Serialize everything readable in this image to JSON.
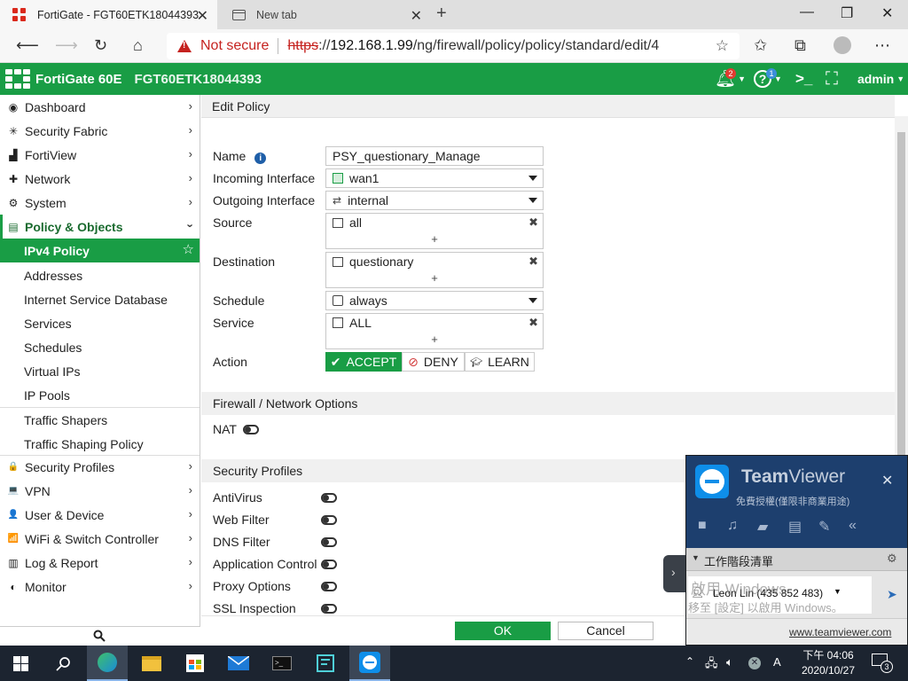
{
  "browser": {
    "tabs": [
      {
        "title": "FortiGate - FGT60ETK18044393",
        "close": "✕"
      },
      {
        "title": "New tab",
        "close": "✕"
      }
    ],
    "new_tab": "+",
    "window_controls": {
      "minimize": "—",
      "restore": "❐",
      "close": "✕"
    },
    "security_label": "Not secure",
    "url_scheme": "https",
    "url_sep": "://",
    "url_host": "192.168.1.99",
    "url_path": "/ng/firewall/policy/policy/standard/edit/4"
  },
  "header": {
    "product": "FortiGate 60E",
    "serial": "FGT60ETK18044393",
    "notif_count": "2",
    "help_count": "1",
    "user": "admin"
  },
  "sidebar": {
    "items": [
      {
        "label": "Dashboard",
        "icon": "dashboard-icon",
        "glyph": "◉"
      },
      {
        "label": "Security Fabric",
        "icon": "fabric-icon",
        "glyph": "✳"
      },
      {
        "label": "FortiView",
        "icon": "chart-icon",
        "glyph": "▟"
      },
      {
        "label": "Network",
        "icon": "network-icon",
        "glyph": "✚"
      },
      {
        "label": "System",
        "icon": "gear-icon",
        "glyph": "⚙"
      },
      {
        "label": "Policy & Objects",
        "icon": "policy-icon",
        "glyph": "▤"
      }
    ],
    "subitems": [
      {
        "label": "IPv4 Policy"
      },
      {
        "label": "Addresses"
      },
      {
        "label": "Internet Service Database"
      },
      {
        "label": "Services"
      },
      {
        "label": "Schedules"
      },
      {
        "label": "Virtual IPs"
      },
      {
        "label": "IP Pools"
      },
      {
        "label": "Traffic Shapers"
      },
      {
        "label": "Traffic Shaping Policy"
      }
    ],
    "items2": [
      {
        "label": "Security Profiles",
        "icon": "lock-icon",
        "glyph": "🔒"
      },
      {
        "label": "VPN",
        "icon": "laptop-icon",
        "glyph": "💻"
      },
      {
        "label": "User & Device",
        "icon": "user-icon",
        "glyph": "👤"
      },
      {
        "label": "WiFi & Switch Controller",
        "icon": "wifi-icon",
        "glyph": "📶"
      },
      {
        "label": "Log & Report",
        "icon": "report-icon",
        "glyph": "▥"
      },
      {
        "label": "Monitor",
        "icon": "monitor-icon",
        "glyph": "◐"
      }
    ]
  },
  "form": {
    "title": "Edit Policy",
    "name_label": "Name",
    "name_value": "PSY_questionary_Manage",
    "incoming_label": "Incoming Interface",
    "incoming_value": "wan1",
    "outgoing_label": "Outgoing Interface",
    "outgoing_value": "internal",
    "source_label": "Source",
    "source_value": "all",
    "destination_label": "Destination",
    "destination_value": "questionary",
    "schedule_label": "Schedule",
    "schedule_value": "always",
    "service_label": "Service",
    "service_value": "ALL",
    "action_label": "Action",
    "actions": {
      "accept": "ACCEPT",
      "deny": "DENY",
      "learn": "LEARN"
    },
    "selected_action": "ACCEPT",
    "remove": "✖",
    "add": "+",
    "firewall_section": "Firewall / Network Options",
    "nat_label": "NAT",
    "nat_enabled": false,
    "security_section": "Security Profiles",
    "profiles": [
      {
        "label": "AntiVirus",
        "enabled": false
      },
      {
        "label": "Web Filter",
        "enabled": false
      },
      {
        "label": "DNS Filter",
        "enabled": false
      },
      {
        "label": "Application Control",
        "enabled": false
      },
      {
        "label": "Proxy Options",
        "enabled": false
      },
      {
        "label": "SSL Inspection",
        "enabled": false
      }
    ],
    "ok": "OK",
    "cancel": "Cancel"
  },
  "teamviewer": {
    "brand_bold": "Team",
    "brand_light": "Viewer",
    "license": "免費授權(僅限非商業用途)",
    "session_header": "工作階段清單",
    "session_entry": "Leon Lin (435 852 483)",
    "activate_line1": "啟用 Windows",
    "activate_line2": "移至 [設定] 以啟用 Windows。",
    "link": "www.teamviewer.com",
    "close": "✕"
  },
  "taskbar": {
    "time": "下午 04:06",
    "date": "2020/10/27",
    "ime": "A",
    "notif_count": "3"
  },
  "colors": {
    "brand_green": "#199d45",
    "teamviewer_blue": "#1d3f6e"
  }
}
